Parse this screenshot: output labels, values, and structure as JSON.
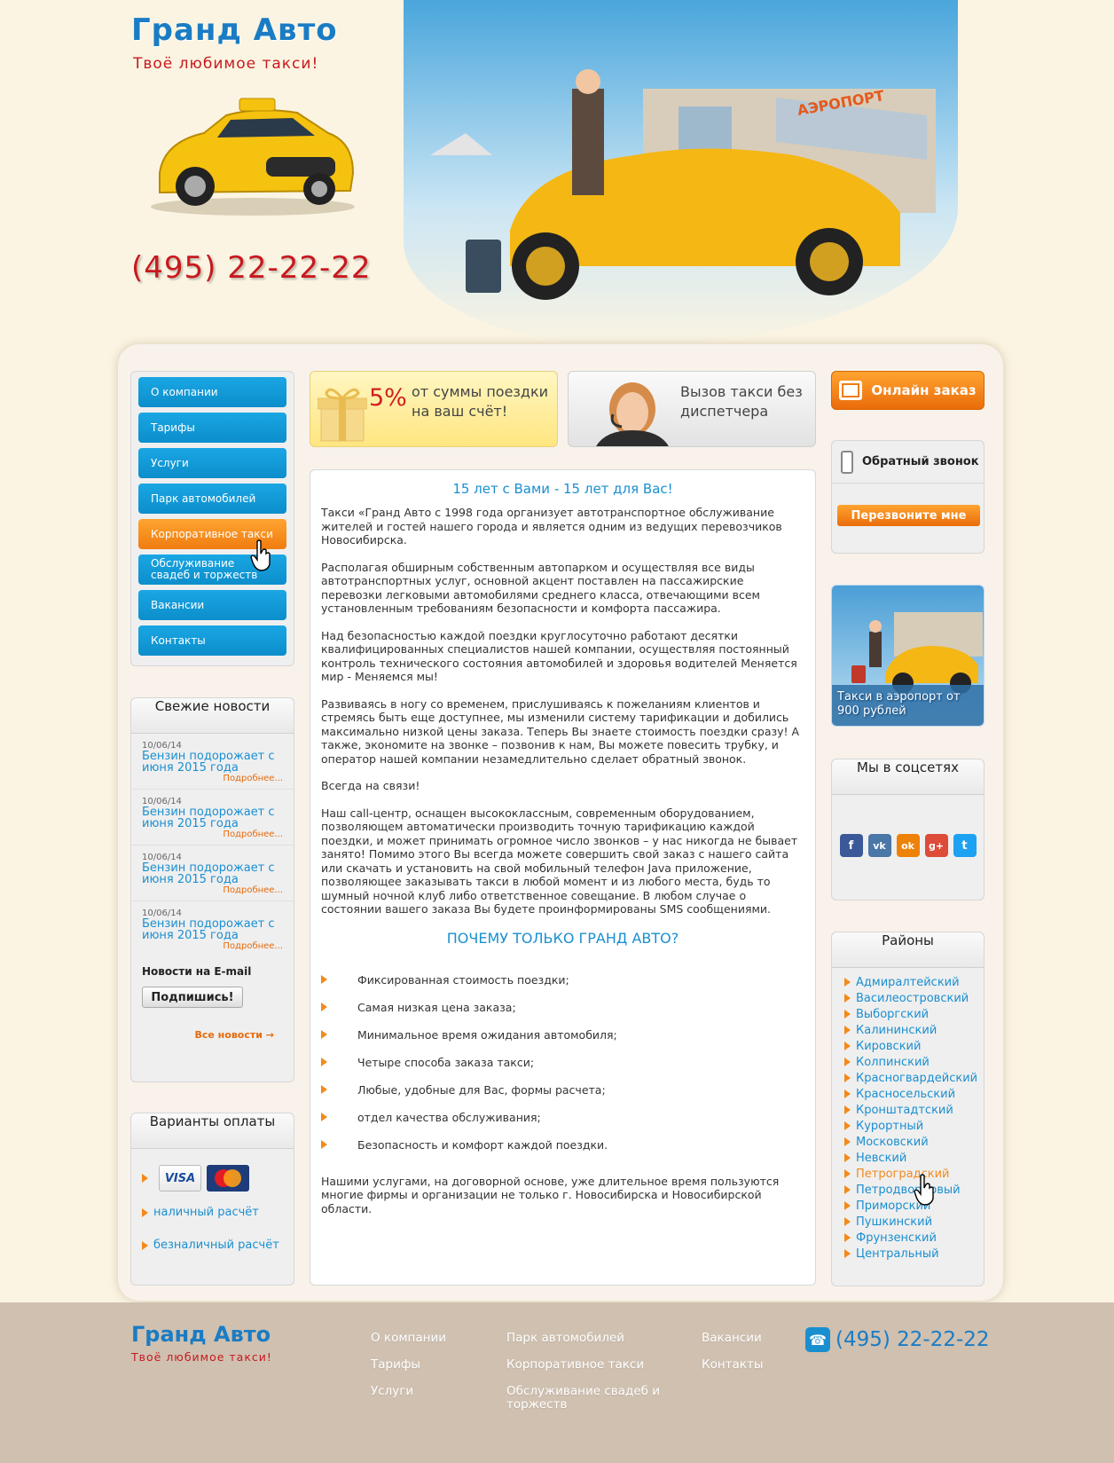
{
  "header": {
    "logo_title": "Гранд Авто",
    "logo_slogan": "Твоё любимое такси!",
    "phone": "(495) 22-22-22",
    "hero_sign": "АЭРОПОРТ"
  },
  "nav": {
    "items": [
      {
        "label": "О компании"
      },
      {
        "label": "Тарифы"
      },
      {
        "label": "Услуги"
      },
      {
        "label": "Парк автомобилей"
      },
      {
        "label": "Корпоративное такси"
      },
      {
        "label": "Обслуживание свадеб и торжеств"
      },
      {
        "label": "Вакансии"
      },
      {
        "label": "Контакты"
      }
    ]
  },
  "news": {
    "title": "Свежие новости",
    "items": [
      {
        "date": "10/06/14",
        "title": "Бензин подорожает с июня 2015 года",
        "more": "Подробнее..."
      },
      {
        "date": "10/06/14",
        "title": "Бензин подорожает с июня 2015 года",
        "more": "Подробнее..."
      },
      {
        "date": "10/06/14",
        "title": "Бензин подорожает с июня 2015 года",
        "more": "Подробнее..."
      },
      {
        "date": "10/06/14",
        "title": "Бензин подорожает с июня 2015 года",
        "more": "Подробнее..."
      }
    ],
    "email_label": "Новости на E-mail",
    "subscribe": "Подпишись!",
    "all_news": "Все новости →"
  },
  "payment": {
    "title": "Варианты оплаты",
    "visa": "VISA",
    "mastercard": "MasterCard",
    "cash": "наличный расчёт",
    "cashless": "безналичный расчёт"
  },
  "promo": {
    "percent": "5%",
    "bonus_text": "от суммы поездки на ваш счёт!",
    "call_text": "Вызов такси без диспетчера"
  },
  "content": {
    "title": "15 лет с Вами - 15 лет для Вас!",
    "paragraphs": [
      "Такси «Гранд Авто с 1998 года организует автотранспортное обслуживание жителей и гостей нашего города и является одним из ведущих перевозчиков Новосибирска.",
      "Располагая обширным собственным автопарком и осуществляя все виды автотранспортных услуг, основной акцент поставлен на пассажирские перевозки легковыми автомобилями среднего класса, отвечающими всем установленным требованиям безопасности и комфорта пассажира.",
      "Над безопасностью каждой поездки круглосуточно работают десятки квалифицированных специалистов нашей компании, осуществляя постоянный контроль технического состояния автомобилей и здоровья водителей Меняется мир - Меняемся мы!",
      "Развиваясь в ногу со временем, прислушиваясь к пожеланиям клиентов и стремясь быть еще доступнее, мы изменили систему тарификации и добились максимально низкой цены заказа. Теперь Вы знаете стоимость поездки сразу! А также, экономите на звонке – позвонив к нам, Вы можете повесить трубку, и оператор нашей компании незамедлительно сделает обратный звонок.",
      "Всегда на связи!",
      "Наш call-центр, оснащен высококлассным, современным оборудованием, позволяющем автоматически производить точную тарификацию каждой поездки, и может принимать огромное число звонков – у нас никогда не бывает занято! Помимо этого Вы всегда можете совершить свой заказ с нашего сайта или скачать и установить на свой мобильный телефон Java приложение, позволяющее заказывать такси в любой момент и из любого места, будь то шумный ночной клуб либо ответственное совещание. В любом случае о состоянии вашего заказа Вы будете проинформированы SMS сообщениями."
    ],
    "why_title": "ПОЧЕМУ ТОЛЬКО ГРАНД АВТО?",
    "why_items": [
      "Фиксированная стоимость поездки;",
      "Самая низкая цена заказа;",
      "Минимальное время ожидания автомобиля;",
      "Четыре способа заказа такси;",
      " Любые, удобные для Вас, формы расчета;",
      "отдел качества обслуживания;",
      "Безопасность и комфорт каждой поездки."
    ],
    "closing": "Нашими услугами, на договорной основе, уже длительное время пользуются многие фирмы и организации не только г. Новосибирска и Новосибирской области."
  },
  "right": {
    "online_order": "Онлайн заказ",
    "callback_title": "Обратный звонок",
    "callback_button": "Перезвоните мне",
    "airport_label": "Такси в аэропорт от 900 рублей",
    "social_title": "Мы в соцсетях",
    "social_icons": [
      {
        "name": "facebook-icon",
        "glyph": "f",
        "color": "#3b5998"
      },
      {
        "name": "vk-icon",
        "glyph": "vk",
        "color": "#4a76a8"
      },
      {
        "name": "odnoklassniki-icon",
        "glyph": "ok",
        "color": "#ee8208"
      },
      {
        "name": "google-plus-icon",
        "glyph": "g+",
        "color": "#dd4b39"
      },
      {
        "name": "twitter-icon",
        "glyph": "t",
        "color": "#1da1f2"
      }
    ],
    "districts_title": "Районы",
    "districts": [
      "Адмиралтейский",
      "Василеостровский",
      "Выборгский",
      "Калининский",
      "Кировский",
      "Колпинский",
      "Красногвардейский",
      "Красносельский",
      "Кронштадтский",
      "Курортный",
      "Московский",
      "Невский",
      "Петроградский",
      "Петродворцовый",
      "Приморский",
      "Пушкинский",
      "Фрунзенский",
      "Центральный"
    ],
    "active_district_index": 12
  },
  "footer": {
    "title": "Гранд Авто",
    "slogan": "Твоё любимое такси!",
    "links": [
      "О компании",
      "Тарифы",
      "Услуги",
      "Парк автомобилей",
      "Корпоративное такси",
      "Обслуживание свадеб и торжеств",
      "Вакансии",
      "Контакты"
    ],
    "phone": "(495) 22-22-22"
  },
  "colors": {
    "brand_blue": "#1a8fd0",
    "accent_orange": "#f07c10",
    "brand_red": "#c8191e"
  }
}
